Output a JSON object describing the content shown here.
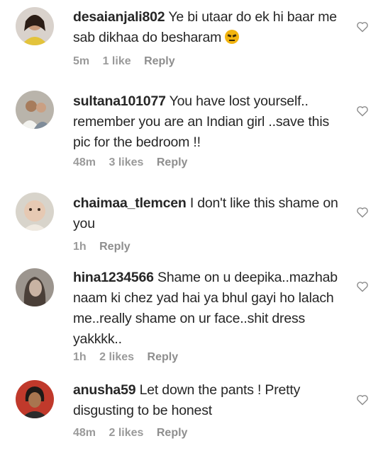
{
  "comments": [
    {
      "username": "desaianjali802",
      "text": "Ye bi utaar do ek hi baar me sab dikhaa do besharam",
      "emoji_icon": "angry-face-icon",
      "time": "5m",
      "likes": "1 like",
      "reply": "Reply"
    },
    {
      "username": "sultana101077",
      "text": "You have lost yourself.. remember you are an Indian girl ..save this pic for the bedroom !!",
      "time": "48m",
      "likes": "3 likes",
      "reply": "Reply"
    },
    {
      "username": "chaimaa_tlemcen",
      "text": "I don't like this shame on you",
      "time": "1h",
      "likes": "",
      "reply": "Reply"
    },
    {
      "username": "hina1234566",
      "text": "Shame on u deepika..mazhab naam ki chez yad hai ya bhul gayi ho lalach me..really shame on ur face..shit dress yakkkk..",
      "time": "1h",
      "likes": "2 likes",
      "reply": "Reply"
    },
    {
      "username": "anusha59",
      "text": "Let down the pants ! Pretty disgusting to be honest",
      "time": "48m",
      "likes": "2 likes",
      "reply": "Reply"
    }
  ],
  "icons": {
    "like": "heart-outline-icon"
  },
  "colors": {
    "text": "#262626",
    "meta": "#8e8e8e",
    "heart": "#8e8e8e"
  }
}
